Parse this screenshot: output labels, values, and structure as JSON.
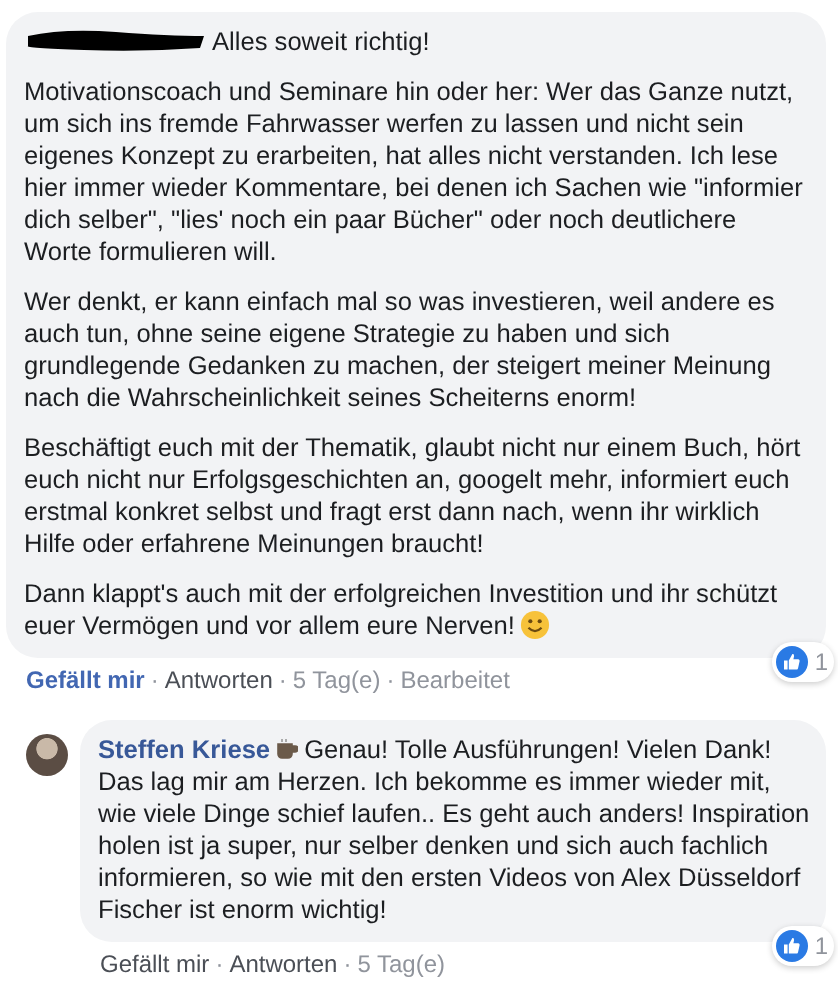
{
  "separator": "·",
  "comments": [
    {
      "reply": false,
      "first_line": "Alles soweit richtig!",
      "paragraphs": [
        "Motivationscoach und Seminare hin oder her: Wer das Ganze nutzt, um sich ins fremde Fahrwasser werfen zu lassen und nicht sein eigenes Konzept zu erarbeiten, hat alles nicht verstanden. Ich lese hier immer wieder Kommentare, bei denen ich Sachen wie \"informier dich selber\", \"lies' noch ein paar Bücher\" oder noch deutlichere Worte formulieren will.",
        "Wer denkt, er kann einfach mal so was investieren, weil andere es auch tun, ohne seine eigene Strategie zu haben und sich grundlegende Gedanken zu machen, der steigert meiner Meinung nach die Wahrscheinlichkeit seines Scheiterns enorm!",
        "Beschäftigt euch mit der Thematik, glaubt nicht nur einem Buch, hört euch nicht nur Erfolgsgeschichten an, googelt mehr, informiert euch erstmal konkret selbst und fragt erst dann nach, wenn ihr wirklich Hilfe oder erfahrene Meinungen braucht!",
        "Dann klappt's auch mit der erfolgreichen Investition und ihr schützt"
      ],
      "closing_line": "euer Vermögen und vor allem eure Nerven!",
      "ends_with_smiley": true,
      "reactions": "1",
      "liked": true,
      "actions": [
        "Gefällt mir",
        "Antworten",
        "5 Tag(e)",
        "Bearbeitet"
      ]
    },
    {
      "author": "Steffen Kriese",
      "author_badge": true,
      "reply": true,
      "first_line": "Genau! Tolle Ausführungen! Vielen Dank!",
      "paragraphs": [
        "Das lag mir am Herzen. Ich bekomme es immer wieder mit, wie viele Dinge schief laufen.. Es geht auch anders! Inspiration holen ist ja super, nur selber denken und sich auch fachlich informieren, so wie mit den ersten Videos von Alex Düsseldorf Fischer ist enorm wichtig!"
      ],
      "reactions": "1",
      "liked": false,
      "actions": [
        "Gefällt mir",
        "Antworten",
        "5 Tag(e)"
      ]
    }
  ]
}
